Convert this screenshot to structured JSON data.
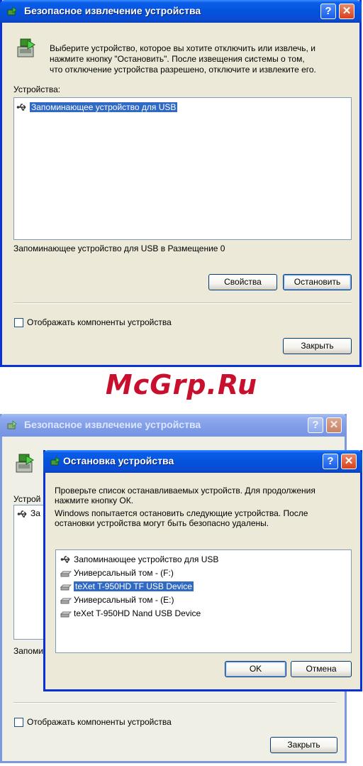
{
  "window1": {
    "title": "Безопасное извлечение устройства",
    "help_glyph": "?",
    "close_glyph": "✕",
    "description": [
      "Выберите устройство, которое вы хотите отключить или извлечь, и",
      "нажмите кнопку \"Остановить\". После извещения системы о том,",
      "что отключение устройства разрешено, отключите и извлеките его."
    ],
    "devices_label": "Устройства:",
    "devices": [
      {
        "label": "Запоминающее устройство для USB",
        "icon": "usb-icon",
        "selected": true
      }
    ],
    "status": "Запоминающее устройство для USB в Размещение 0",
    "properties_button": "Свойства",
    "stop_button": "Остановить",
    "show_components_label": "Отображать компоненты устройства",
    "close_button": "Закрыть"
  },
  "watermark": "McGrp.Ru",
  "window2": {
    "title": "Безопасное извлечение устройства",
    "help_glyph": "?",
    "close_glyph": "✕",
    "devices_label_partial": "Устрой",
    "device_partial": "За",
    "status_partial": "Запоми",
    "show_components_label": "Отображать компоненты устройства",
    "close_button": "Закрыть"
  },
  "dialog": {
    "title": "Остановка устройства",
    "help_glyph": "?",
    "close_glyph": "✕",
    "text": [
      "Проверьте список останавливаемых устройств. Для продолжения",
      "нажмите кнопку ОК.",
      "Windows попытается остановить следующие устройства. После",
      "остановки устройства могут быть безопасно удалены."
    ],
    "devices": [
      {
        "label": "Запоминающее устройство для USB",
        "icon": "usb-icon",
        "selected": false
      },
      {
        "label": "Универсальный том - (F:)",
        "icon": "drive-icon",
        "selected": false
      },
      {
        "label": "teXet T-950HD TF USB Device",
        "icon": "drive-icon",
        "selected": true
      },
      {
        "label": "Универсальный том - (E:)",
        "icon": "drive-icon",
        "selected": false
      },
      {
        "label": "teXet T-950HD Nand USB Device",
        "icon": "drive-icon",
        "selected": false
      }
    ],
    "ok_button": "OK",
    "cancel_button": "Отмена"
  },
  "colors": {
    "titlebar_active": "#0453dd",
    "titlebar_inactive": "#7f9ce8",
    "selection": "#316ac5",
    "window_bg": "#ece9d8",
    "watermark": "#c8102e"
  }
}
